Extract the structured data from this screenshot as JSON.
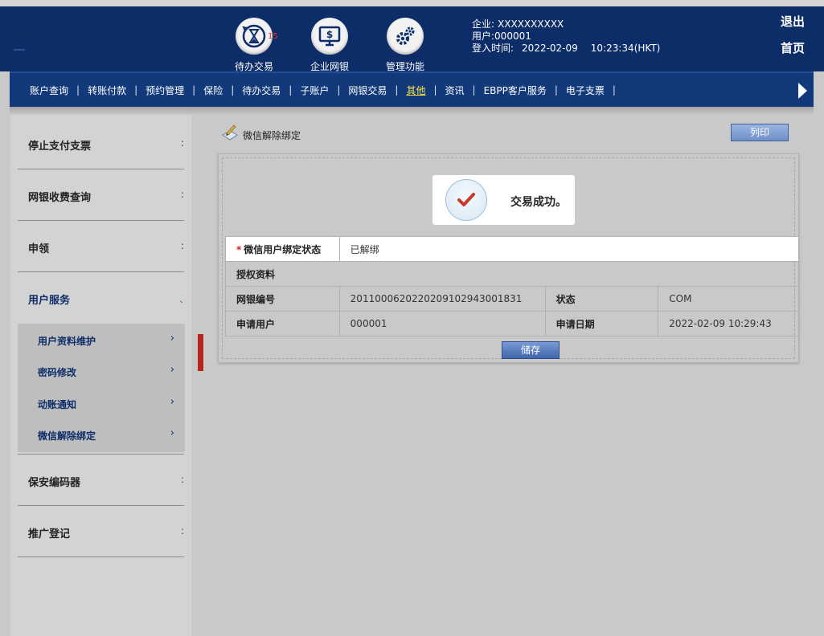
{
  "header": {
    "icons": [
      {
        "label": "待办交易",
        "badge": "15",
        "icon": "hourglass-refresh-icon"
      },
      {
        "label": "企业网银",
        "icon": "monitor-dollar-icon"
      },
      {
        "label": "管理功能",
        "icon": "gears-icon"
      }
    ],
    "user": {
      "company_label": "企业:",
      "company_value": "XXXXXXXXXX",
      "user_label": "用户:",
      "user_value": "000001",
      "login_label": "登入时间:",
      "login_date": "2022-02-09",
      "login_time": "10:23:34(HKT)"
    },
    "logout": "退出",
    "home": "首页"
  },
  "nav": {
    "items": [
      {
        "label": "账户查询"
      },
      {
        "label": "转账付款"
      },
      {
        "label": "预约管理"
      },
      {
        "label": "保险"
      },
      {
        "label": "待办交易"
      },
      {
        "label": "子账户"
      },
      {
        "label": "网银交易"
      },
      {
        "label": "其他",
        "active": true
      },
      {
        "label": "资讯"
      },
      {
        "label": "EBPP客户服务"
      },
      {
        "label": "电子支票"
      }
    ],
    "separator": "|"
  },
  "sidebar": {
    "items": [
      {
        "label": "停止支付支票"
      },
      {
        "label": "网银收费查询"
      },
      {
        "label": "申领"
      },
      {
        "label": "用户服务"
      },
      {
        "label": "保安编码器"
      },
      {
        "label": "推广登记"
      }
    ],
    "submenu": [
      {
        "label": "用户资料维护"
      },
      {
        "label": "密码修改"
      },
      {
        "label": "动账通知"
      },
      {
        "label": "微信解除绑定"
      }
    ]
  },
  "main": {
    "title": "微信解除绑定",
    "print_label": "列印",
    "success_message": "交易成功。",
    "status_row": {
      "label": "微信用户绑定状态",
      "required": "*",
      "value": "已解绑"
    },
    "section_title": "授权资料",
    "rows": [
      {
        "label1": "网银编号",
        "value1": "20110006202202091029430018З1",
        "label2": "状态",
        "value2": "COM"
      },
      {
        "label1": "申请用户",
        "value1": "000001",
        "label2": "申请日期",
        "value2": "2022-02-09 10:29:43"
      }
    ],
    "save_label": "储存"
  },
  "colors": {
    "header_bg": "#0d2d69",
    "nav_bg": "#123a7a",
    "active_nav": "#f7e44a",
    "accent_red": "#b8251c",
    "button_blue": "#3f66ad"
  }
}
